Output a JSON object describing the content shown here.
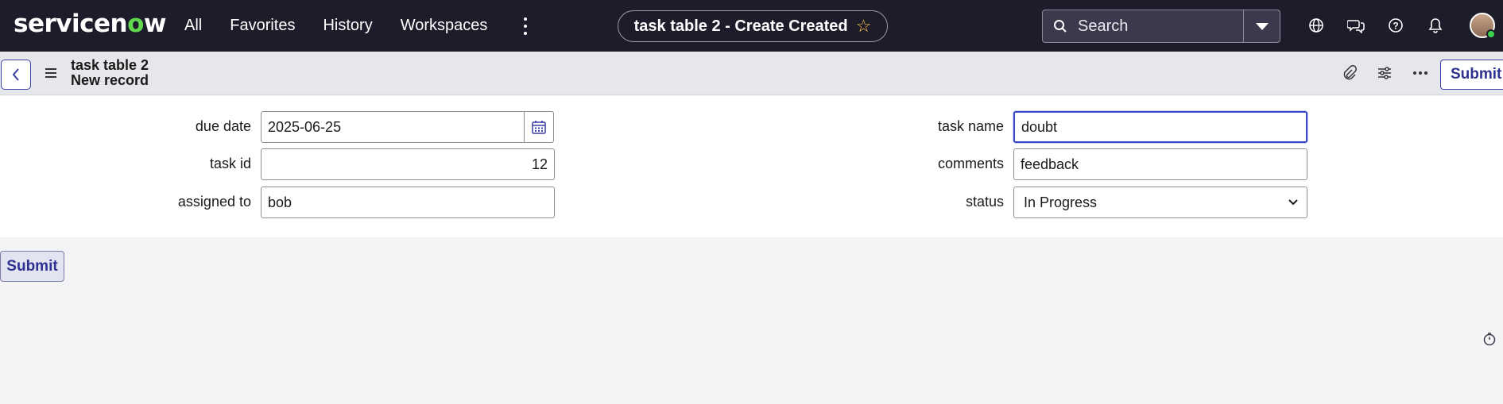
{
  "brand": {
    "logo_pre": "servicen",
    "logo_o": "o",
    "logo_post": "w"
  },
  "nav": {
    "items": [
      {
        "label": "All"
      },
      {
        "label": "Favorites"
      },
      {
        "label": "History"
      },
      {
        "label": "Workspaces"
      }
    ]
  },
  "header": {
    "context_title": "task table 2 - Create Created",
    "search_placeholder": "Search"
  },
  "record": {
    "table": "task table 2",
    "subtitle": "New record",
    "submit_label": "Submit"
  },
  "form": {
    "due_date": {
      "label": "due date",
      "value": "2025-06-25"
    },
    "task_id": {
      "label": "task id",
      "value": "12"
    },
    "assigned_to": {
      "label": "assigned to",
      "value": "bob"
    },
    "task_name": {
      "label": "task name",
      "value": "doubt"
    },
    "comments": {
      "label": "comments",
      "value": "feedback"
    },
    "status": {
      "label": "status",
      "value": "In Progress"
    }
  },
  "footer": {
    "submit_label": "Submit"
  },
  "colors": {
    "nav_bg": "#1c1c2b",
    "accent": "#3b3fa6",
    "brand_green": "#62d84e"
  }
}
